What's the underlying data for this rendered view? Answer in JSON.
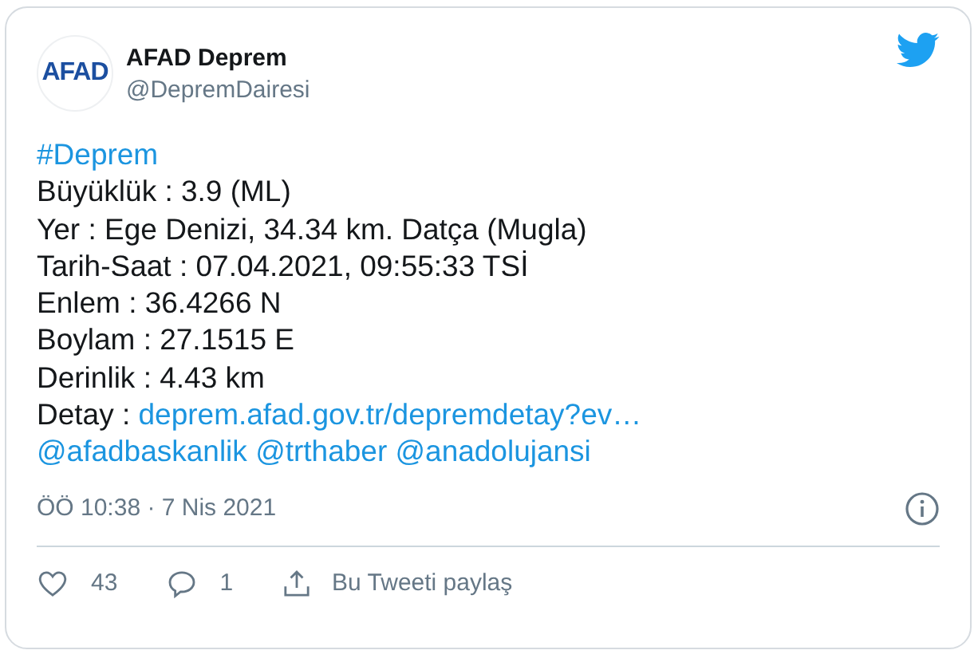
{
  "author": {
    "logo": "AFAD",
    "name": "AFAD Deprem",
    "handle": "@DepremDairesi"
  },
  "lines": [
    {
      "segments": [
        {
          "text": "#Deprem",
          "link": true
        }
      ]
    },
    {
      "segments": [
        {
          "text": "Büyüklük : 3.9 (ML)",
          "link": false
        }
      ]
    },
    {
      "segments": [
        {
          "text": "Yer : Ege Denizi, 34.34 km. Datça (Mugla)",
          "link": false
        }
      ]
    },
    {
      "segments": [
        {
          "text": "Tarih-Saat : 07.04.2021, 09:55:33 TSİ",
          "link": false
        }
      ]
    },
    {
      "segments": [
        {
          "text": "Enlem : 36.4266 N",
          "link": false
        }
      ]
    },
    {
      "segments": [
        {
          "text": "Boylam : 27.1515 E",
          "link": false
        }
      ]
    },
    {
      "segments": [
        {
          "text": "Derinlik : 4.43 km",
          "link": false
        }
      ]
    },
    {
      "segments": [
        {
          "text": "Detay :",
          "link": false
        },
        {
          "text": "deprem.afad.gov.tr/depremdetay?ev…",
          "link": true
        }
      ]
    },
    {
      "segments": [
        {
          "text": "@afadbaskanlik",
          "link": true
        },
        {
          "text": "@trthaber",
          "link": true
        },
        {
          "text": "@anadolujansi",
          "link": true
        }
      ]
    }
  ],
  "timestamp": "ÖÖ 10:38 · 7 Nis 2021",
  "actions": [
    {
      "kind": "like",
      "label": "43"
    },
    {
      "kind": "reply",
      "label": "1"
    },
    {
      "kind": "share",
      "label": "Bu Tweeti paylaş"
    }
  ]
}
